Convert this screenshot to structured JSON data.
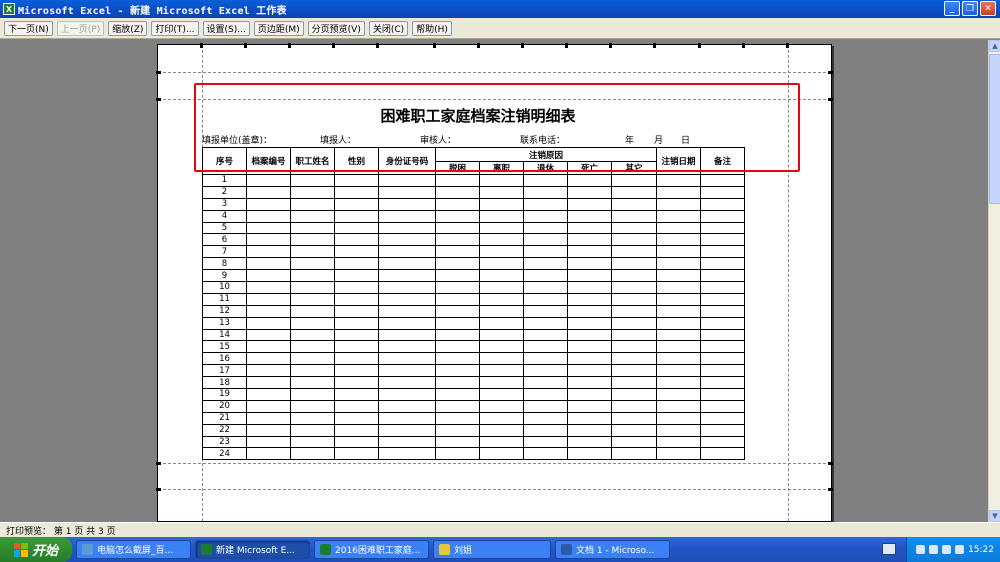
{
  "window": {
    "app_icon": "excel-icon",
    "title": "Microsoft Excel - 新建 Microsoft Excel 工作表",
    "controls": [
      "minimize-icon",
      "restore-icon",
      "close-icon"
    ]
  },
  "toolbar": {
    "next_page": "下一页(N)",
    "prev_page": "上一页(P)",
    "zoom": "缩放(Z)",
    "print": "打印(T)...",
    "setup": "设置(S)...",
    "margins": "页边距(M)",
    "page_break_preview": "分页预览(V)",
    "close": "关闭(C)",
    "help": "帮助(H)"
  },
  "sheet": {
    "title": "困难职工家庭档案注销明细表",
    "meta": {
      "unit": "填报单位(盖章)：",
      "filler": "填报人：",
      "reviewer": "审核人：",
      "phone": "联系电话：",
      "year": "年",
      "month": "月",
      "day": "日"
    },
    "headers": {
      "seq": "序号",
      "archive_no": "档案编号",
      "name": "职工姓名",
      "gender": "性别",
      "id_no": "身份证号码",
      "reason": "注销原因",
      "reason_poverty": "脱困",
      "reason_leave": "离职",
      "reason_retire": "退休",
      "reason_death": "死亡",
      "reason_other": "其它",
      "date": "注销日期",
      "note": "备注"
    },
    "rows": [
      "1",
      "2",
      "3",
      "4",
      "5",
      "6",
      "7",
      "8",
      "9",
      "10",
      "11",
      "12",
      "13",
      "14",
      "15",
      "16",
      "17",
      "18",
      "19",
      "20",
      "21",
      "22",
      "23",
      "24"
    ]
  },
  "status": {
    "text": "打印预览： 第 1 页  共 3 页"
  },
  "taskbar": {
    "start": "开始",
    "tasks": [
      {
        "label": "电脑怎么截屏_百...",
        "icon": "browser-icon",
        "color": "#5b9bd5"
      },
      {
        "label": "新建 Microsoft E...",
        "icon": "excel-icon",
        "color": "#1e7b34"
      },
      {
        "label": "2016困难职工家庭...",
        "icon": "excel-icon",
        "color": "#1e7b34"
      },
      {
        "label": "刘姐",
        "icon": "folder-icon",
        "color": "#e7c53a"
      },
      {
        "label": "文档 1 - Microso...",
        "icon": "word-icon",
        "color": "#2a5caa"
      }
    ],
    "clock": "15:22"
  },
  "colors": {
    "highlight": "#e30613",
    "titlebar": "#0a5fd8",
    "taskbar": "#245edb"
  }
}
